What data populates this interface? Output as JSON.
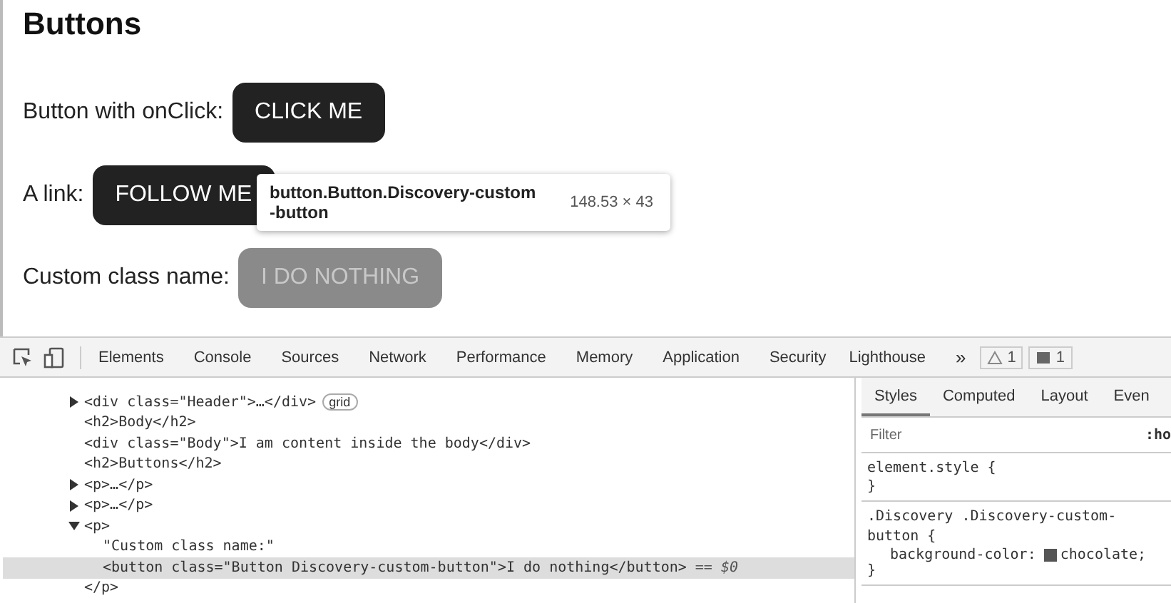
{
  "page": {
    "heading": "Buttons",
    "rows": [
      {
        "label": "Button with onClick:",
        "button": "CLICK ME",
        "kind": "dark"
      },
      {
        "label": "A link:",
        "button": "FOLLOW ME",
        "kind": "dark"
      },
      {
        "label": "Custom class name:",
        "button": "I DO NOTHING",
        "kind": "inspected"
      }
    ],
    "tooltip": {
      "selector": "button.Button.Discovery-custom\n-button",
      "size": "148.53 × 43"
    }
  },
  "devtools": {
    "tabs": [
      "Elements",
      "Console",
      "Sources",
      "Network",
      "Performance",
      "Memory",
      "Application",
      "Security",
      "Lighthouse"
    ],
    "more": "»",
    "warnings": "1",
    "messages": "1",
    "dom": [
      {
        "text": "<div class=\"Header\">…</div>",
        "expanded": false,
        "badge": "grid"
      },
      {
        "text": "<h2>Body</h2>"
      },
      {
        "text": "<div class=\"Body\">I am content inside the body</div>"
      },
      {
        "text": "<h2>Buttons</h2>"
      },
      {
        "text": "<p>…</p>",
        "expanded": false
      },
      {
        "text": "<p>…</p>",
        "expanded": false
      },
      {
        "text": "<p>",
        "expanded": true,
        "closing": "</p>",
        "children": [
          {
            "text": "\"Custom class name:\"",
            "selected": false
          },
          {
            "text": "<button class=\"Button Discovery-custom-button\">I do nothing</button>",
            "selected": true,
            "suffix": "== $0"
          }
        ]
      }
    ],
    "styles": {
      "tabs": [
        {
          "label": "Styles",
          "selected": true
        },
        {
          "label": "Computed",
          "selected": false
        },
        {
          "label": "Layout",
          "selected": false
        },
        {
          "label": "Even",
          "selected": false
        }
      ],
      "filter_placeholder": "Filter",
      "hov": ":ho",
      "rules": [
        {
          "selector": "element.style {",
          "close": "}"
        },
        {
          "selector": ".Discovery .Discovery-custom-\nbutton {",
          "property": "background-color:",
          "value": "chocolate;",
          "close": "}"
        }
      ]
    }
  }
}
